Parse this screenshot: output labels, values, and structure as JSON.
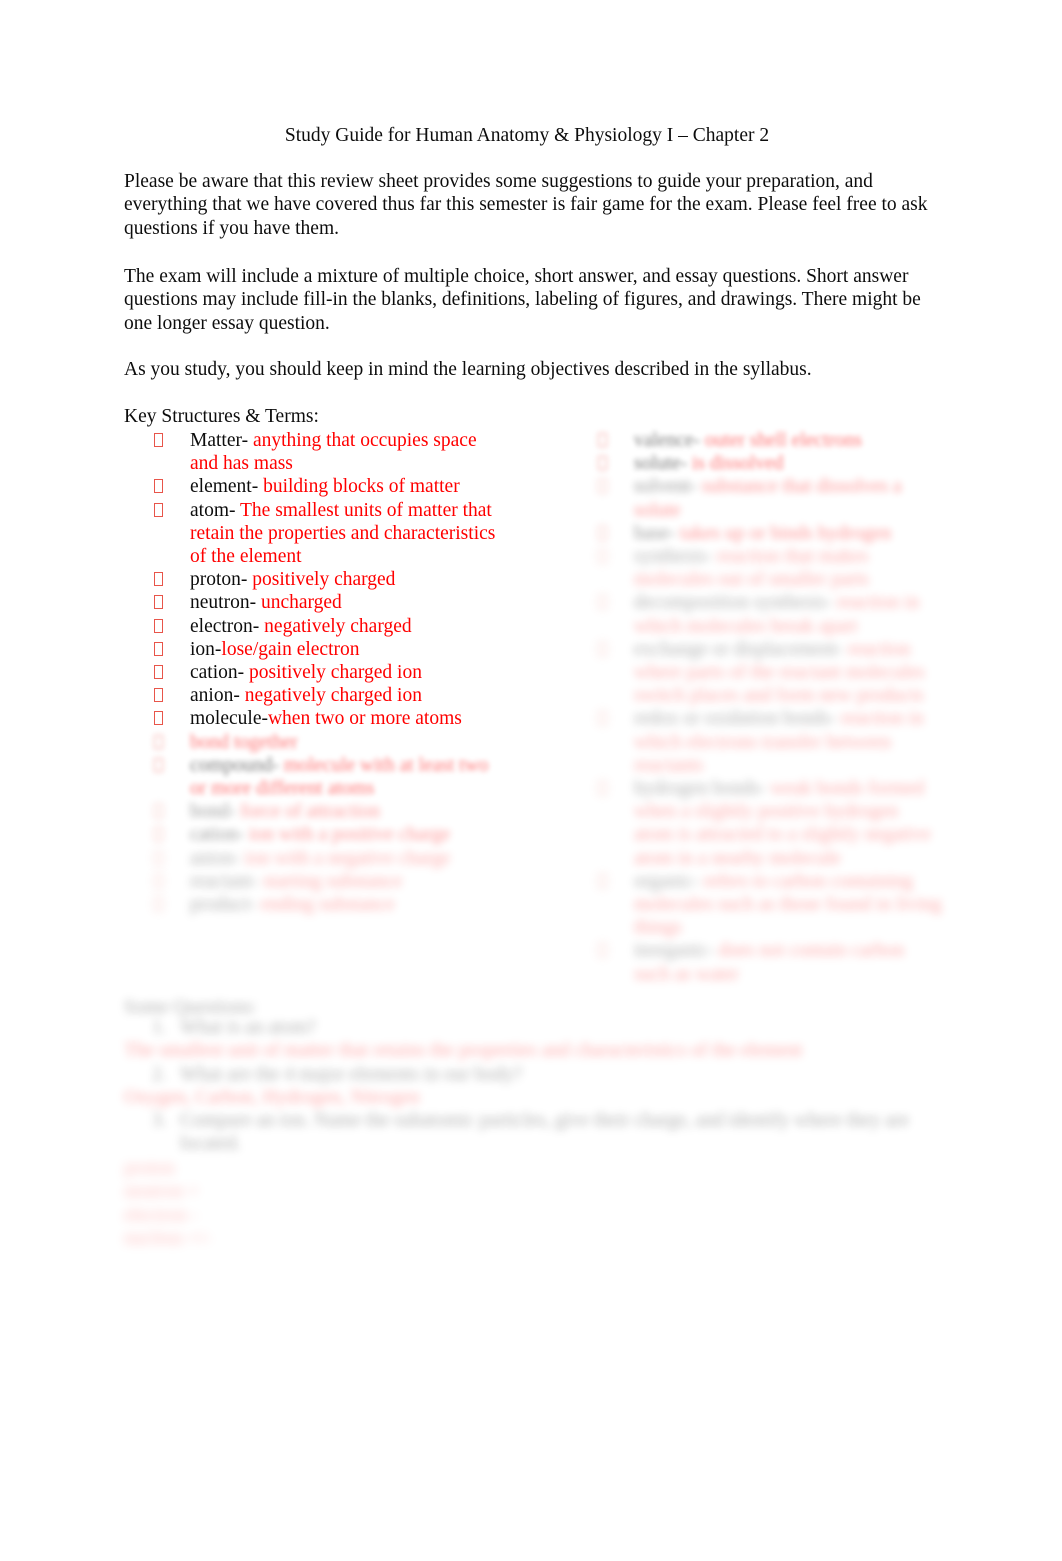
{
  "document": {
    "title": "Study Guide for Human Anatomy & Physiology I – Chapter 2",
    "accent_color": "#ff0000",
    "text_color": "#0d0d0d",
    "background_color": "#ffffff"
  },
  "paragraphs": {
    "intro": "Please be aware that this review sheet provides some   suggestions to guide your preparation,    and everything that we have covered thus far this semester is fair game for the exam.    Please feel free to ask questions if you have them.",
    "exam": "The exam will include a mixture of multiple choice, short answer, and essay questions.   Short answer questions may include fill-in the blanks, definitions, labeling of figures, and drawings.  There might be one longer essay question.",
    "study": "As you study, you should keep in mind the learning objectives described in the syllabus."
  },
  "key_terms": {
    "heading": "Key Structures & Terms:",
    "left_column": [
      {
        "term": "Matter- ",
        "definition": "anything that occupies space and has mass",
        "legible": true
      },
      {
        "term": "element- ",
        "definition": " building blocks of matter",
        "legible": true
      },
      {
        "term": "atom- ",
        "definition": " The smallest units of matter that retain the properties and characteristics of the element",
        "legible": true
      },
      {
        "term": "proton- ",
        "definition": "positively charged",
        "legible": true
      },
      {
        "term": "neutron- ",
        "definition": " uncharged",
        "legible": true
      },
      {
        "term": "electron- ",
        "definition": " negatively charged",
        "legible": true
      },
      {
        "term": "ion-",
        "definition": "lose/gain electron",
        "legible": true
      },
      {
        "term": "cation- ",
        "definition": " positively charged ion",
        "legible": true
      },
      {
        "term": "anion- ",
        "definition": " negatively charged ion",
        "legible": true
      },
      {
        "term": "molecule-",
        "definition": "when two or more atoms",
        "legible": true
      },
      {
        "term": "",
        "definition": "bond together",
        "legible": false
      },
      {
        "term": "compound- ",
        "definition": "molecule with at least two or more different atoms",
        "legible": false
      },
      {
        "term": "bond- ",
        "definition": "force of attraction",
        "legible": false
      },
      {
        "term": "cation- ",
        "definition": "ion with a positive charge",
        "legible": false
      },
      {
        "term": "anion- ",
        "definition": "ion with a negative charge",
        "legible": false
      },
      {
        "term": "reactant- ",
        "definition": "starting substance",
        "legible": false
      },
      {
        "term": "product- ",
        "definition": "ending substance",
        "legible": false
      }
    ],
    "right_column": [
      {
        "term": "valence- ",
        "definition": "outer shell electrons",
        "legible": false
      },
      {
        "term": "solute- ",
        "definition": "is dissolved",
        "legible": false
      },
      {
        "term": "solvent- ",
        "definition": "substance that dissolves a solute",
        "legible": false
      },
      {
        "term": "base- ",
        "definition": "takes up or binds hydrogen",
        "legible": false
      },
      {
        "term": "synthesis- ",
        "definition": "reaction that makes molecules out of smaller parts",
        "legible": false
      },
      {
        "term": "decomposition synthesis- ",
        "definition": "reaction in which molecules break apart",
        "legible": false
      },
      {
        "term": "exchange or displacement- ",
        "definition": "reaction where parts of the reactant molecules switch places and form new products",
        "legible": false
      },
      {
        "term": "redox or oxidation bonds- ",
        "definition": "reaction in which electrons transfer between reactants",
        "legible": false
      },
      {
        "term": "hydrogen bonds- ",
        "definition": "weak bonds formed when a slightly positive hydrogen atom is attracted to a slightly negative atom in a nearby molecule",
        "legible": false
      },
      {
        "term": "organic- ",
        "definition": "refers to carbon containing molecules such as those found in living things",
        "legible": false
      },
      {
        "term": "inorganic- ",
        "definition": "does not contain carbon such as water",
        "legible": false
      }
    ]
  },
  "questions_section": {
    "heading": "Some Questions:",
    "items": [
      {
        "number": "1.",
        "question": "What is an atom?",
        "answer": "The smallest unit of matter that retains the properties and characteristics of the element",
        "legible": false
      },
      {
        "number": "2.",
        "question": "What are the 4 major elements in our body?",
        "answer": "Oxygen, Carbon, Hydrogen, Nitrogen",
        "legible": false
      },
      {
        "number": "3.",
        "question": "Compare an ion.  Name the subatomic particles, give their charge, and identify where they are located.",
        "answer": "",
        "legible": false
      }
    ],
    "tail_lines": [
      "proton",
      "neutron +",
      "electron -",
      "nucleus +/-"
    ]
  }
}
